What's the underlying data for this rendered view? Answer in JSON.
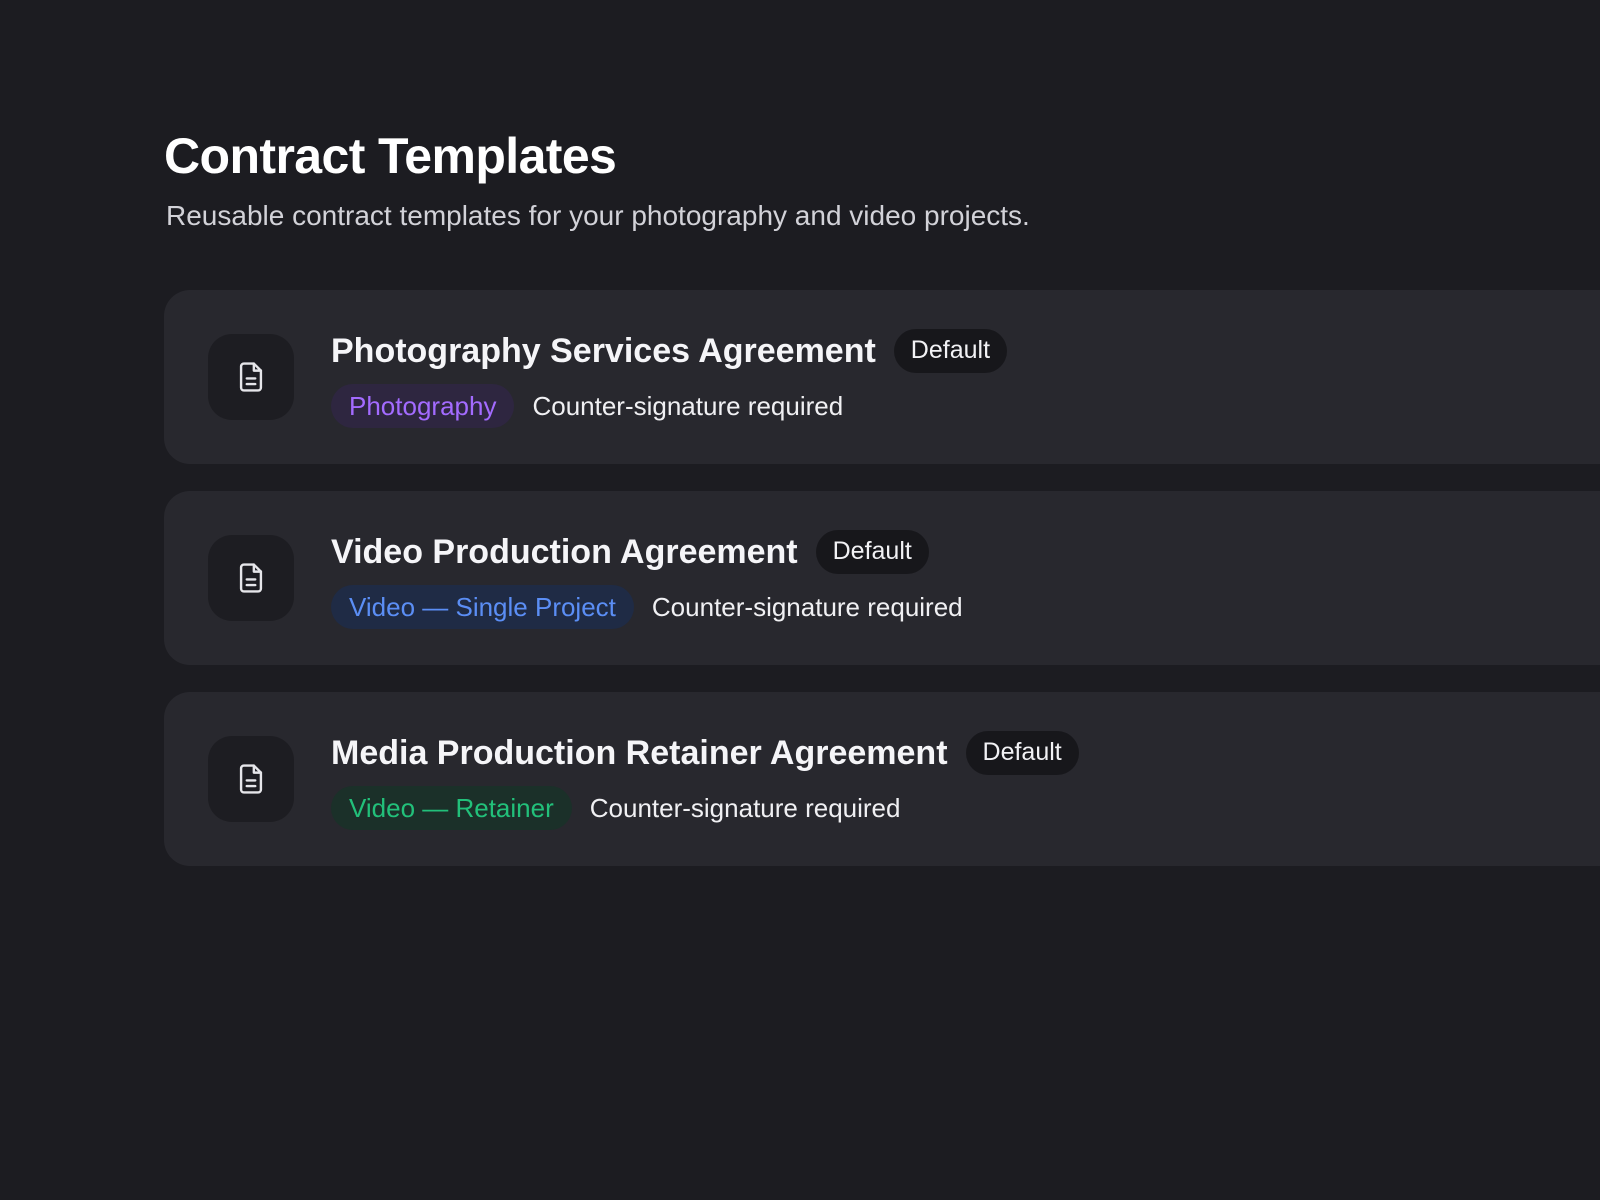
{
  "header": {
    "title": "Contract Templates",
    "subtitle": "Reusable contract templates for your photography and video projects."
  },
  "templates": [
    {
      "name": "Photography Services Agreement",
      "badge": "Default",
      "category": "Photography",
      "category_color": "#a36bff",
      "category_bg": "#2e2640",
      "signature_note": "Counter-signature required",
      "icon": "document-icon"
    },
    {
      "name": "Video Production Agreement",
      "badge": "Default",
      "category": "Video — Single Project",
      "category_color": "#5b8ef5",
      "category_bg": "#1f2b45",
      "signature_note": "Counter-signature required",
      "icon": "document-icon"
    },
    {
      "name": "Media Production Retainer Agreement",
      "badge": "Default",
      "category": "Video — Retainer",
      "category_color": "#22c07a",
      "category_bg": "#1b3029",
      "signature_note": "Counter-signature required",
      "icon": "document-icon"
    }
  ],
  "colors": {
    "background": "#1c1c21",
    "card": "#28282e",
    "icon_tile": "#1d1d22",
    "badge_bg": "#17171b"
  }
}
